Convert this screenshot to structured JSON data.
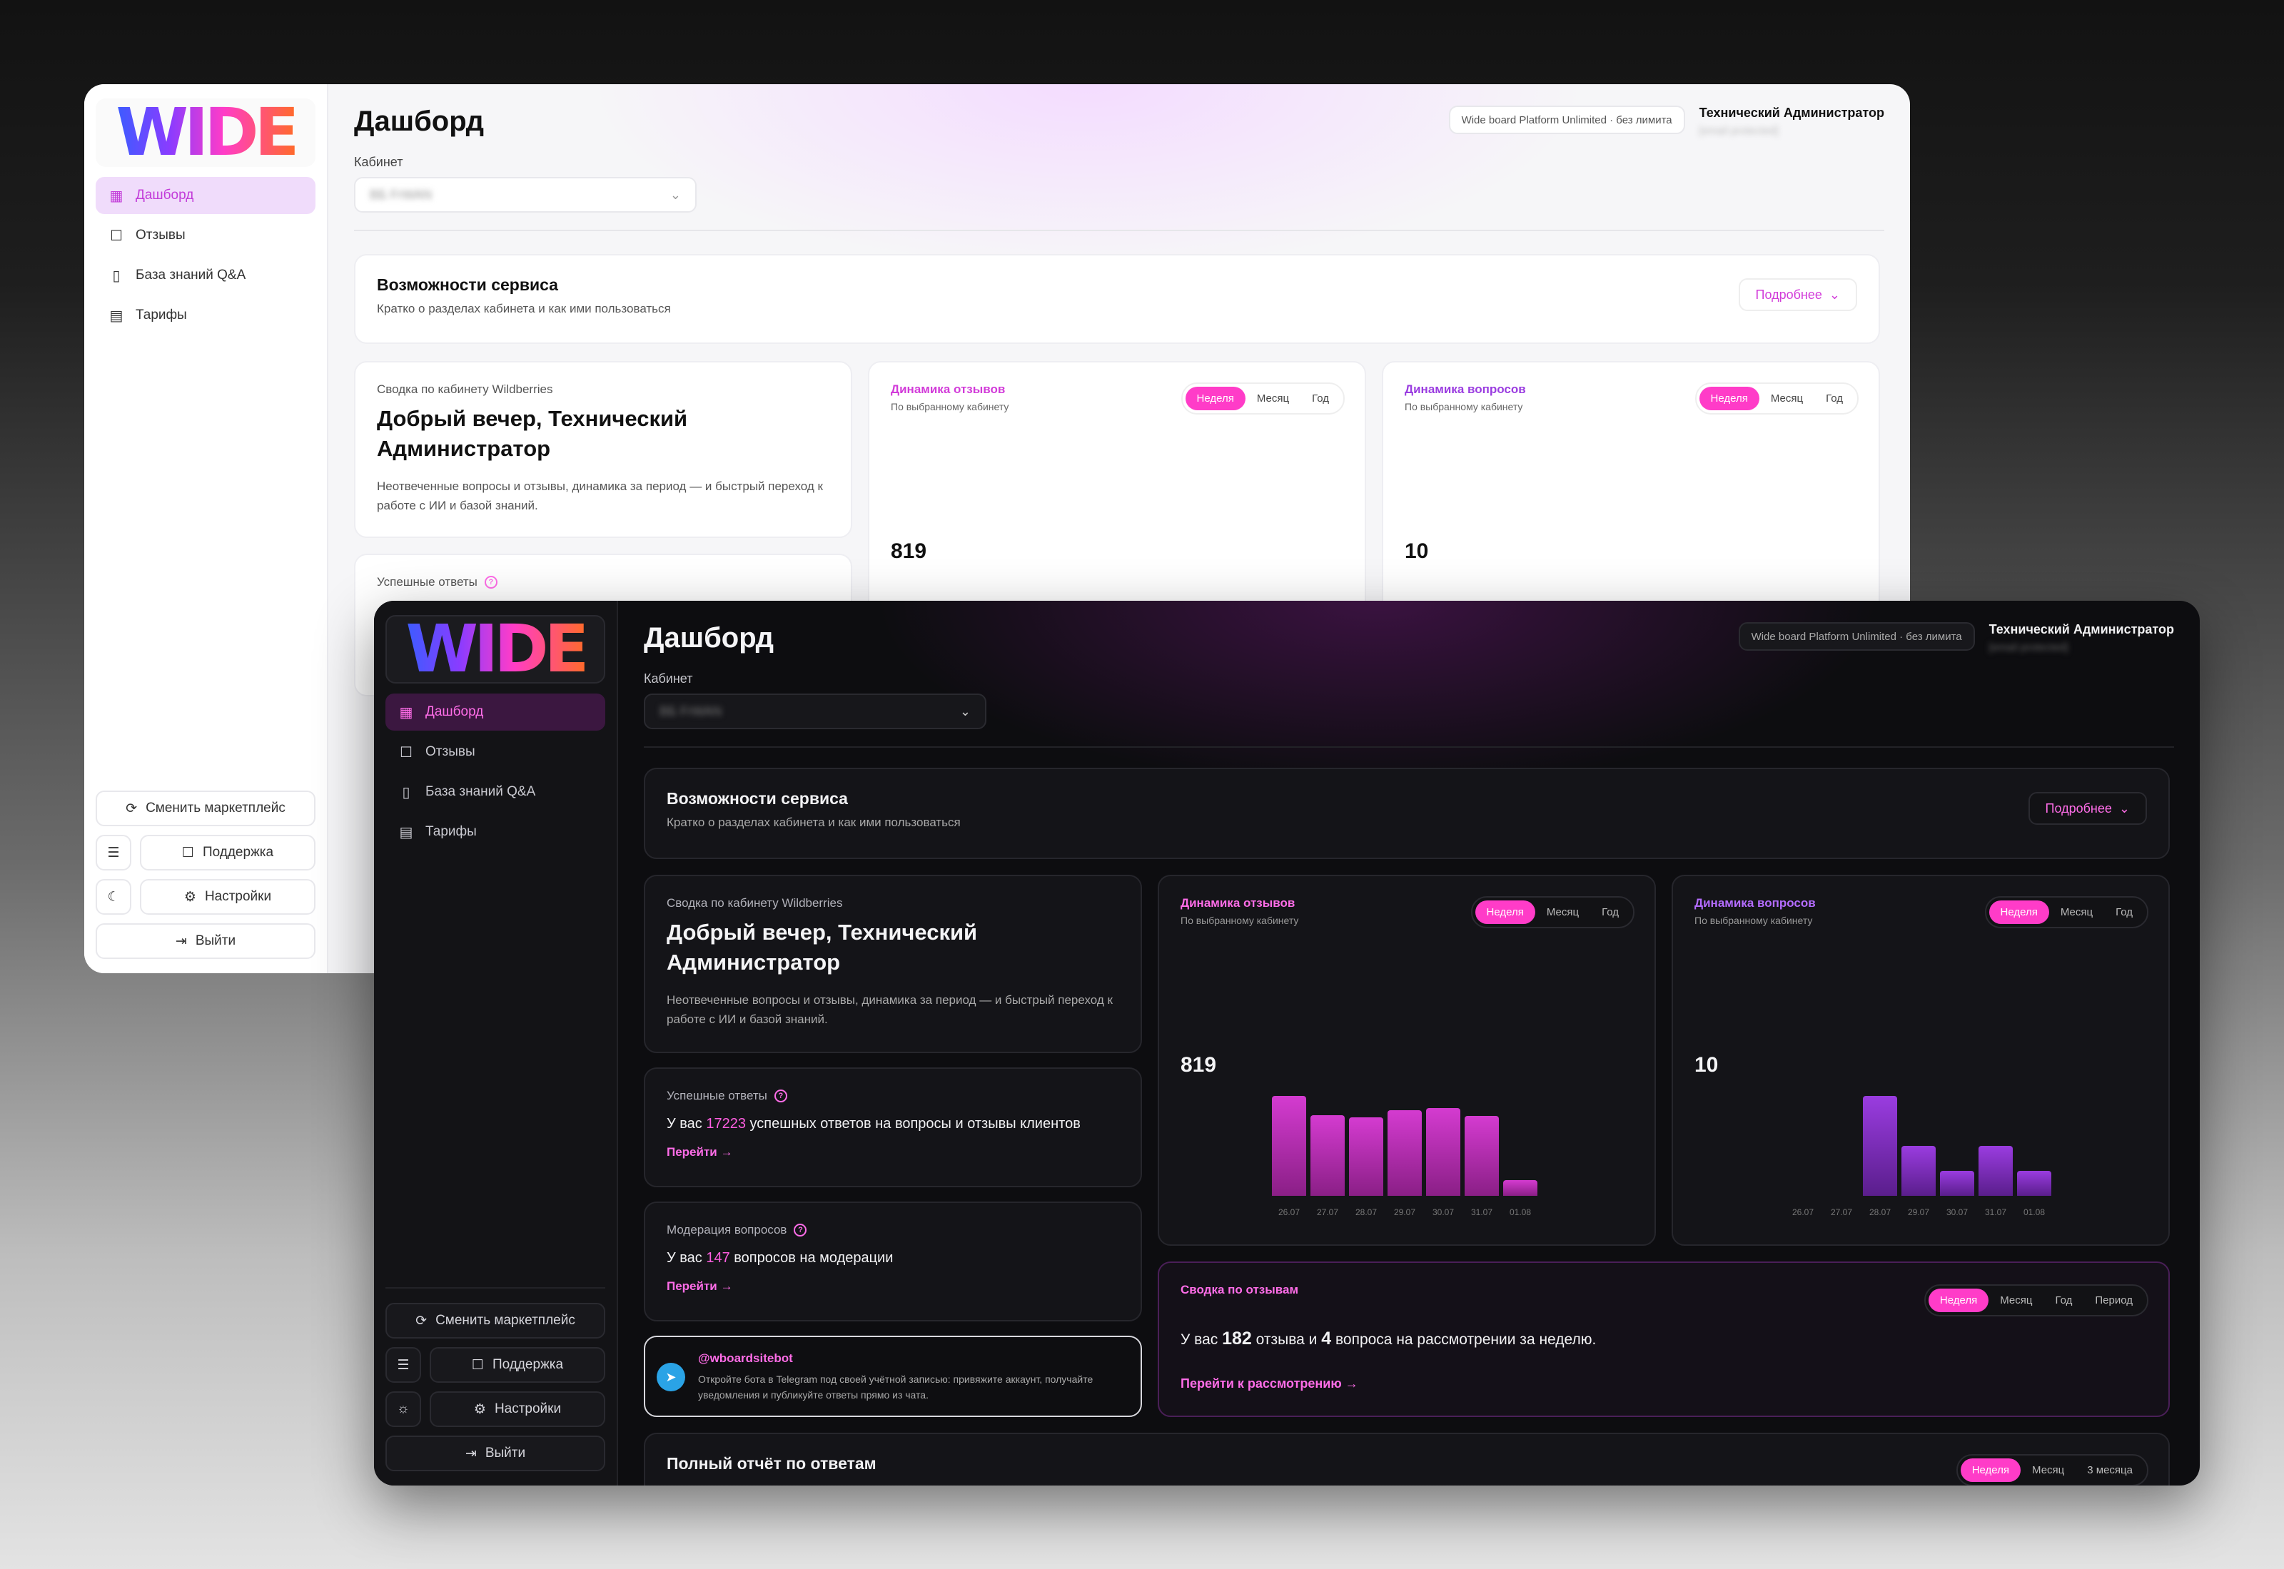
{
  "logo_text": "WIDE",
  "nav": {
    "items": [
      {
        "label": "Дашборд",
        "icon": "grid-icon"
      },
      {
        "label": "Отзывы",
        "icon": "message-icon"
      },
      {
        "label": "База знаний Q&A",
        "icon": "book-icon"
      },
      {
        "label": "Тарифы",
        "icon": "receipt-icon"
      }
    ]
  },
  "sidebar_bottom": {
    "switch_marketplace": "Сменить маркетплейс",
    "support": "Поддержка",
    "settings": "Настройки",
    "logout": "Выйти"
  },
  "header": {
    "title": "Дашборд",
    "cabinet_label": "Кабинет",
    "cabinet_value": "ВБ FrWAN",
    "plan": "Wide board Platform Unlimited · без лимита",
    "user_name": "Технический Администратор",
    "user_email": "[email protected]"
  },
  "features": {
    "title": "Возможности сервиса",
    "subtitle": "Кратко о разделах кабинета и как ими пользоваться",
    "more_label": "Подробнее"
  },
  "greeting": {
    "caption": "Сводка по кабинету Wildberries",
    "title": "Добрый вечер, Технический Администратор",
    "description": "Неотвеченные вопросы и отзывы, динамика за период — и быстрый переход к работе с ИИ и базой знаний."
  },
  "periods": {
    "week": "Неделя",
    "month": "Месяц",
    "year": "Год",
    "period": "Период",
    "three_months": "3 месяца"
  },
  "reviews_chart": {
    "title": "Динамика отзывов",
    "subtitle": "По выбранному кабинету",
    "total": "819"
  },
  "questions_chart": {
    "title": "Динамика вопросов",
    "subtitle": "По выбранному кабинету",
    "total": "10"
  },
  "chart_data": [
    {
      "type": "bar",
      "title": "Динамика отзывов",
      "categories": [
        "26.07",
        "27.07",
        "28.07",
        "29.07",
        "30.07",
        "31.07",
        "01.08"
      ],
      "values": [
        140,
        113,
        110,
        120,
        123,
        112,
        22
      ],
      "color": "#d43bd0"
    },
    {
      "type": "bar",
      "title": "Динамика вопросов",
      "categories": [
        "26.07",
        "27.07",
        "28.07",
        "29.07",
        "30.07",
        "31.07",
        "01.08"
      ],
      "values": [
        0,
        0,
        4,
        2,
        1,
        2,
        1
      ],
      "color": "#9a3ce0"
    }
  ],
  "success": {
    "title": "Успешные ответы",
    "text_before": "У вас ",
    "count": "17223",
    "text_after": " успешных ответов на вопросы и отзывы клиентов",
    "link": "Перейти →"
  },
  "moderation": {
    "title": "Модерация вопросов",
    "text_before": "У вас ",
    "count": "147",
    "text_after": " вопросов на модерации",
    "link": "Перейти →"
  },
  "telegram": {
    "handle": "@wboardsitebot",
    "description": "Откройте бота в Telegram под своей учётной записью: привяжите аккаунт, получайте уведомления и публикуйте ответы прямо из чата."
  },
  "reviews_summary": {
    "title": "Сводка по отзывам",
    "text_1": "У вас ",
    "reviews": "182",
    "text_2": " отзыва и ",
    "questions": "4",
    "text_3": " вопроса на рассмотрении за неделю.",
    "link": "Перейти к рассмотрению →"
  },
  "full_report": {
    "title": "Полный отчёт по ответам"
  },
  "colors": {
    "accent": "#ff3cc8",
    "accent_text": "#ff6de8",
    "purple": "#9a3ce0"
  }
}
